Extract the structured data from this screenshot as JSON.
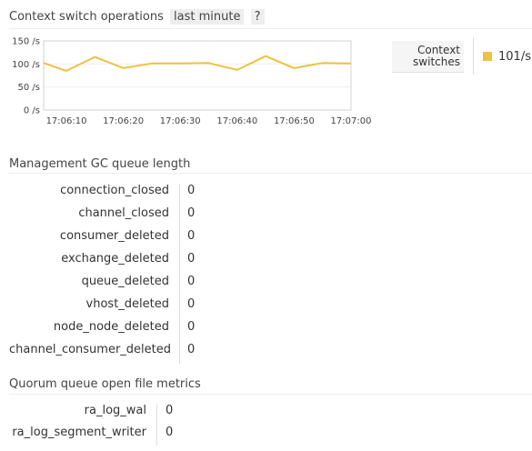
{
  "context_switch": {
    "title": "Context switch operations",
    "range_label": "last minute",
    "help_label": "?",
    "legend": {
      "series_label": "Context switches",
      "current_value": "101/s",
      "color": "#edc240"
    }
  },
  "chart_data": {
    "type": "line",
    "y_unit": "/s",
    "ylim": [
      0,
      150
    ],
    "y_ticks": [
      "150 /s",
      "100 /s",
      "50 /s",
      "0 /s"
    ],
    "y_tick_values": [
      150,
      100,
      50,
      0
    ],
    "xlim": [
      "17:06:06",
      "17:07:00"
    ],
    "x_ticks": [
      "17:06:10",
      "17:06:20",
      "17:06:30",
      "17:06:40",
      "17:06:50",
      "17:07:00"
    ],
    "grid": true,
    "series": [
      {
        "color": "#edc240",
        "x": [
          "17:06:06",
          "17:06:10",
          "17:06:15",
          "17:06:20",
          "17:06:25",
          "17:06:30",
          "17:06:35",
          "17:06:40",
          "17:06:45",
          "17:06:50",
          "17:06:55",
          "17:07:00"
        ],
        "values": [
          102,
          85,
          115,
          91,
          101,
          101,
          102,
          87,
          117,
          91,
          102,
          101
        ]
      }
    ]
  },
  "gc_queue": {
    "title": "Management GC queue length",
    "rows": [
      {
        "label": "connection_closed",
        "value": "0"
      },
      {
        "label": "channel_closed",
        "value": "0"
      },
      {
        "label": "consumer_deleted",
        "value": "0"
      },
      {
        "label": "exchange_deleted",
        "value": "0"
      },
      {
        "label": "queue_deleted",
        "value": "0"
      },
      {
        "label": "vhost_deleted",
        "value": "0"
      },
      {
        "label": "node_node_deleted",
        "value": "0"
      },
      {
        "label": "channel_consumer_deleted",
        "value": "0"
      }
    ]
  },
  "quorum": {
    "title": "Quorum queue open file metrics",
    "rows": [
      {
        "label": "ra_log_wal",
        "value": "0"
      },
      {
        "label": "ra_log_segment_writer",
        "value": "0"
      }
    ]
  }
}
